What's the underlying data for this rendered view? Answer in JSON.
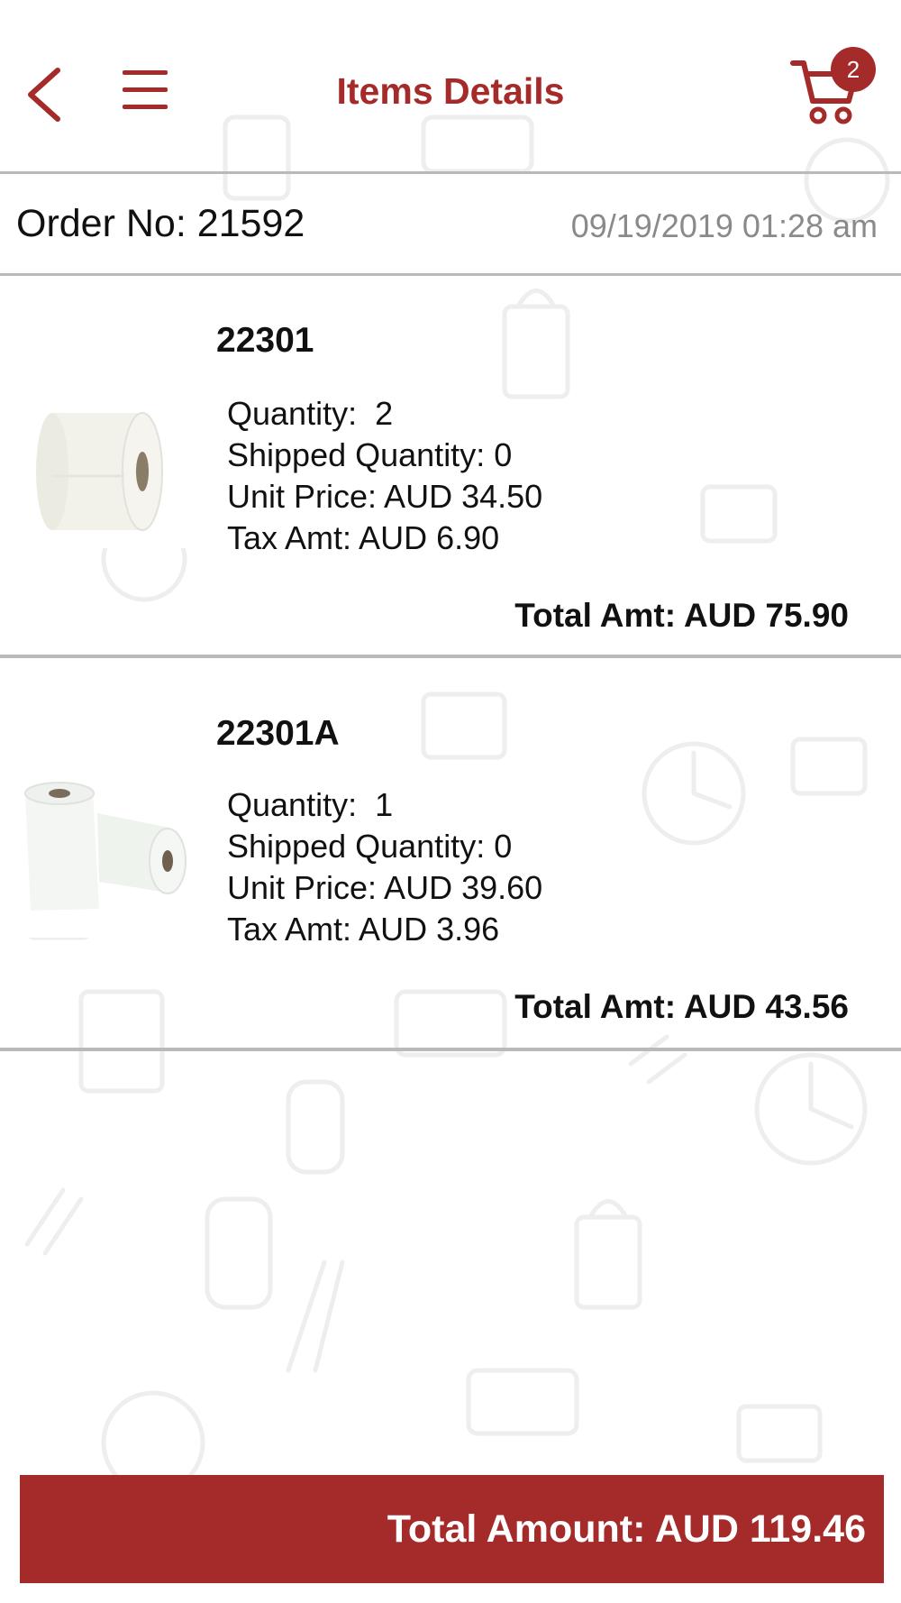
{
  "header": {
    "title": "Items Details",
    "cart_count": "2"
  },
  "order": {
    "number_label": "Order No: 21592",
    "datetime": "09/19/2019 01:28 am"
  },
  "items": [
    {
      "sku": "22301",
      "quantity": "Quantity:  2",
      "shipped": "Shipped Quantity: 0",
      "unit_price": "Unit Price: AUD 34.50",
      "tax": "Tax Amt: AUD 6.90",
      "total": "Total Amt: AUD 75.90"
    },
    {
      "sku": "22301A",
      "quantity": "Quantity:  1",
      "shipped": "Shipped Quantity: 0",
      "unit_price": "Unit Price: AUD 39.60",
      "tax": "Tax Amt: AUD 3.96",
      "total": "Total Amt: AUD 43.56"
    }
  ],
  "footer": {
    "total_amount": "Total Amount: AUD 119.46"
  },
  "colors": {
    "accent": "#a52a2a",
    "divider": "#b9b9b9",
    "muted_text": "#8a8a8a"
  },
  "icons": [
    "back-chevron-icon",
    "hamburger-menu-icon",
    "shopping-cart-icon",
    "paper-towel-roll-image"
  ]
}
